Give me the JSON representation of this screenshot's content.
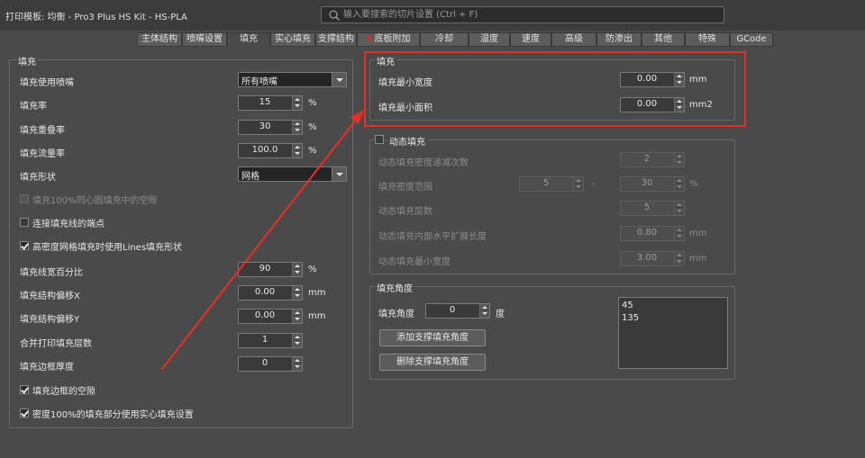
{
  "window": {
    "title": "打印模板: 均衡 - Pro3 Plus HS Kit - HS-PLA"
  },
  "search": {
    "placeholder": "输入要搜索的切片设置 (Ctrl + F)"
  },
  "tabs": [
    "主体结构",
    "喷嘴设置",
    "填充",
    "实心填充",
    "支撑结构",
    "底板附加",
    "冷却",
    "温度",
    "速度",
    "高级",
    "防渗出",
    "其他",
    "特殊",
    "GCode"
  ],
  "active_tab": "填充",
  "left_group": {
    "title": "填充",
    "nozzle": {
      "label": "填充使用喷嘴",
      "value": "所有喷嘴"
    },
    "rate": {
      "label": "填充率",
      "value": "15",
      "unit": "%"
    },
    "overlap": {
      "label": "填充重叠率",
      "value": "30",
      "unit": "%"
    },
    "flow": {
      "label": "填充流量率",
      "value": "100.0",
      "unit": "%"
    },
    "shape": {
      "label": "填充形状",
      "value": "网格"
    },
    "check_gap100": {
      "label": "填充100%同心圆填充中的空隙",
      "checked": false,
      "enabled": false
    },
    "check_connect": {
      "label": "连接填充线的端点",
      "checked": false
    },
    "check_lines": {
      "label": "高密度网格填充时使用Lines填充形状",
      "checked": true
    },
    "width_pct": {
      "label": "填充线宽百分比",
      "value": "90",
      "unit": "%"
    },
    "offset_x": {
      "label": "填充结构偏移X",
      "value": "0.00",
      "unit": "mm"
    },
    "offset_y": {
      "label": "填充结构偏移Y",
      "value": "0.00",
      "unit": "mm"
    },
    "combine": {
      "label": "合并打印填充层数",
      "value": "1"
    },
    "border": {
      "label": "填充边框厚度",
      "value": "0"
    },
    "check_border_gap": {
      "label": "填充边框的空隙",
      "checked": true
    },
    "check_solid": {
      "label": "密度100%的填充部分使用实心填充设置",
      "checked": true
    }
  },
  "right_fill": {
    "title": "填充",
    "min_width": {
      "label": "填充最小宽度",
      "value": "0.00",
      "unit": "mm"
    },
    "min_area": {
      "label": "填充最小面积",
      "value": "0.00",
      "unit": "mm2"
    }
  },
  "dynamic": {
    "title": "动态填充",
    "checked": false,
    "decrease": {
      "label": "动态填充密度递减次数",
      "value": "2"
    },
    "range": {
      "label": "填充密度范围",
      "from": "5",
      "dash": "–",
      "to": "30",
      "unit": "%"
    },
    "layers": {
      "label": "动态填充层数",
      "value": "5"
    },
    "expand": {
      "label": "动态填充内部水平扩展长度",
      "value": "0.80",
      "unit": "mm"
    },
    "min_width": {
      "label": "动态填充最小宽度",
      "value": "3.00",
      "unit": "mm"
    }
  },
  "angle": {
    "title": "填充角度",
    "label": "填充角度",
    "value": "0",
    "unit": "度",
    "add_button": "添加支撑填充角度",
    "remove_button": "删除支撑填充角度",
    "list": [
      "45",
      "135"
    ]
  },
  "colors": {
    "annotation": "#e0302a"
  }
}
